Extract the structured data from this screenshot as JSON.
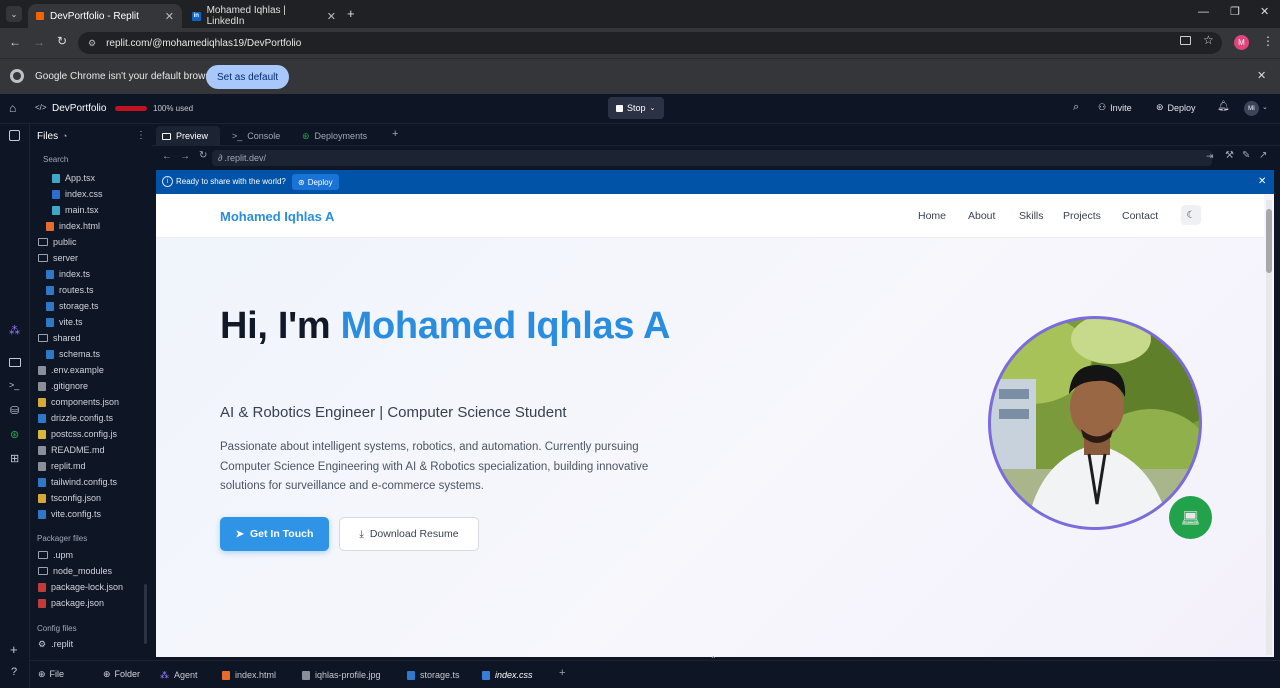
{
  "browser": {
    "tabs": [
      {
        "title": "DevPortfolio - Replit",
        "icon": "replit-icon"
      },
      {
        "title": "Mohamed Iqhlas | LinkedIn",
        "icon": "linkedin-icon"
      }
    ],
    "url": "replit.com/@mohamediqhlas19/DevPortfolio",
    "infobar_text": "Google Chrome isn't your default browser",
    "infobar_button": "Set as default",
    "profile_initial": "M"
  },
  "replit": {
    "project_name": "DevPortfolio",
    "usage_text": "100% used",
    "usage_fraction": 1.0,
    "stop_label": "Stop",
    "invite_label": "Invite",
    "deploy_label": "Deploy",
    "user_initials": "MI",
    "files_header": "Files",
    "search_label": "Search",
    "file_tree": [
      {
        "name": "App.tsx",
        "kind": "react"
      },
      {
        "name": "index.css",
        "kind": "css"
      },
      {
        "name": "main.tsx",
        "kind": "react"
      },
      {
        "name": "index.html",
        "kind": "html"
      },
      {
        "name": "public",
        "kind": "folder"
      },
      {
        "name": "server",
        "kind": "folder-open"
      },
      {
        "name": "index.ts",
        "kind": "ts"
      },
      {
        "name": "routes.ts",
        "kind": "ts"
      },
      {
        "name": "storage.ts",
        "kind": "ts"
      },
      {
        "name": "vite.ts",
        "kind": "ts"
      },
      {
        "name": "shared",
        "kind": "folder-open"
      },
      {
        "name": "schema.ts",
        "kind": "ts"
      },
      {
        "name": ".env.example",
        "kind": "file"
      },
      {
        "name": ".gitignore",
        "kind": "file"
      },
      {
        "name": "components.json",
        "kind": "json"
      },
      {
        "name": "drizzle.config.ts",
        "kind": "ts"
      },
      {
        "name": "postcss.config.js",
        "kind": "js"
      },
      {
        "name": "README.md",
        "kind": "md"
      },
      {
        "name": "replit.md",
        "kind": "md"
      },
      {
        "name": "tailwind.config.ts",
        "kind": "ts"
      },
      {
        "name": "tsconfig.json",
        "kind": "json"
      },
      {
        "name": "vite.config.ts",
        "kind": "ts"
      }
    ],
    "packager_header": "Packager files",
    "packager_files": [
      ".upm",
      "node_modules",
      "package-lock.json",
      "package.json"
    ],
    "config_header": "Config files",
    "config_files": [
      ".replit"
    ],
    "footer_file": "File",
    "footer_folder": "Folder",
    "panel_tabs": [
      "Preview",
      "Console",
      "Deployments"
    ],
    "preview_url": ".replit.dev/",
    "banner_text": "Ready to share with the world?",
    "banner_button": "Deploy",
    "bottom_tabs": [
      "Agent",
      "index.html",
      "iqhlas-profile.jpg",
      "storage.ts",
      "index.css"
    ]
  },
  "site": {
    "brand": "Mohamed Iqhlas A",
    "nav": [
      "Home",
      "About",
      "Skills",
      "Projects",
      "Contact"
    ],
    "hero_prefix": "Hi, I'm ",
    "hero_name": "Mohamed Iqhlas A",
    "subtitle": "AI & Robotics Engineer | Computer Science Student",
    "description": "Passionate about intelligent systems, robotics, and automation. Currently pursuing Computer Science Engineering with AI & Robotics specialization, building innovative solutions for surveillance and e-commerce systems.",
    "cta_primary": "Get In Touch",
    "cta_secondary": "Download Resume"
  },
  "colors": {
    "accent": "#2a8de0",
    "replit_bg": "#0e1525",
    "banner_bg": "#0053a6",
    "avatar_ring": "#7b6be0",
    "badge": "#22a24a"
  }
}
